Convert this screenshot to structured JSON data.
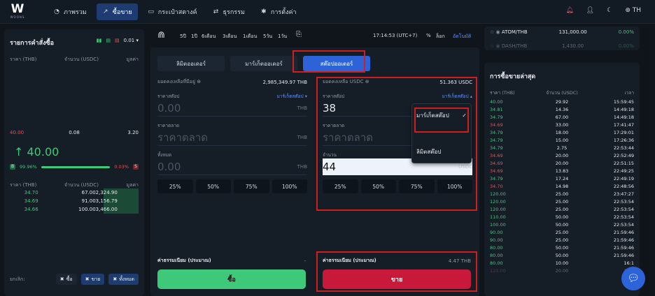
{
  "brand": {
    "mark": "W",
    "name": "WOONS"
  },
  "nav": [
    {
      "icon": "◔",
      "label": "ภาพรวม"
    },
    {
      "icon": "↗",
      "label": "ซื้อขาย"
    },
    {
      "icon": "▭",
      "label": "กระเป๋าสตางค์"
    },
    {
      "icon": "⇄",
      "label": "ธุรกรรม"
    },
    {
      "icon": "✱",
      "label": "การตั้งค่า"
    }
  ],
  "top_right": {
    "lang": "TH"
  },
  "orderbook": {
    "title": "รายการคำสั่งซื้อ",
    "tick": "0.01",
    "cols": [
      "ราคา (THB)",
      "จำนวน (USDC)",
      "มูลค่า"
    ],
    "ask": {
      "price": "40.00",
      "qty": "0.08",
      "value": "3.20"
    },
    "last_price": "↑ 40.00",
    "buy_pct": "99.96%",
    "sell_pct": "0.03%",
    "buy_badge": "B",
    "sell_badge": "S",
    "bid_cols": [
      "ราคา (THB)",
      "จำนวน (USDC)",
      "มูลค่า"
    ],
    "bids": [
      {
        "price": "34.70",
        "qty": "67.00",
        "value": "2,324.90"
      },
      {
        "price": "34.69",
        "qty": "91.00",
        "value": "3,156.79"
      },
      {
        "price": "34.66",
        "qty": "100.00",
        "value": "3,466.00"
      }
    ],
    "footer_label": "ยกเลิก:",
    "footer_buttons": [
      "ซื้อ",
      "ขาย",
      "ทั้งหมด"
    ]
  },
  "chart_toolbar": {
    "ranges": [
      "5ปี",
      "1ปี",
      "6เดือน",
      "3เดือน",
      "1เดือน",
      "5วัน",
      "1วัน"
    ],
    "time": "17:14:53 (UTC+7)",
    "pct": "%",
    "log": "ล็อก",
    "auto": "อัตโนมัติ"
  },
  "order_form": {
    "tabs": [
      "ลิมิตออเดอร์",
      "มาร์เก็ตออเดอร์",
      "สต๊อปออเดอร์"
    ],
    "buy": {
      "balance_label": "ยอดคงเหลือที่มีอยู่",
      "balance": "2,985,349.97 THB",
      "stop_label": "ราคาสต๊อป",
      "stop_select": "มาร์เก็ตสต๊อป",
      "stop_value": "0.00",
      "unit": "THB",
      "price_label": "ราคาตลาด",
      "price_value": "ราคาตลาด",
      "total_label": "ทั้งหมด",
      "total_value": "0.00",
      "pcts": [
        "25%",
        "50%",
        "75%",
        "100%"
      ],
      "fee_label": "ค่าธรรมเนียม (ประมาณ)",
      "fee_value": "-",
      "button": "ซื้อ"
    },
    "sell": {
      "balance_label": "ยอดคงเหลือ USDC",
      "balance": "51.363 USDC",
      "stop_label": "ราคาสต๊อป",
      "stop_select": "มาร์เก็ตสต๊อป",
      "stop_value": "38",
      "price_label": "ราคาตลาด",
      "price_value": "ราคาตลาด",
      "amount_label": "จำนวน",
      "amount_value": "44",
      "amount_unit": "USDC",
      "pcts": [
        "25%",
        "50%",
        "75%",
        "100%"
      ],
      "fee_label": "ค่าธรรมเนียม (ประมาณ)",
      "fee_value": "4.47 THB",
      "button": "ขาย"
    },
    "dropdown": {
      "options": [
        "มาร์เก็ตสต๊อป",
        "ลิมิตสต๊อป"
      ]
    }
  },
  "ticker": {
    "rows": [
      {
        "pair": "ATOM/THB",
        "price": "131,000.00",
        "chg": "0.00%"
      },
      {
        "pair": "DASH/THB",
        "price": "1,430.00",
        "chg": "0.00%"
      }
    ]
  },
  "trades": {
    "title": "การซื้อขายล่าสุด",
    "cols": [
      "ราคา (THB)",
      "จำนวน (USDC)",
      "เวลา"
    ],
    "rows": [
      {
        "p": "40.00",
        "q": "29.92",
        "t": "15:59:45",
        "s": "g"
      },
      {
        "p": "34.81",
        "q": "14.36",
        "t": "14:49:18",
        "s": "g"
      },
      {
        "p": "34.79",
        "q": "67.00",
        "t": "14:49:18",
        "s": "g"
      },
      {
        "p": "34.69",
        "q": "33.00",
        "t": "17:41:47",
        "s": "r"
      },
      {
        "p": "34.79",
        "q": "18.00",
        "t": "17:29:01",
        "s": "g"
      },
      {
        "p": "34.79",
        "q": "15.00",
        "t": "17:26:36",
        "s": "g"
      },
      {
        "p": "34.79",
        "q": "2.75",
        "t": "22:53:44",
        "s": "g"
      },
      {
        "p": "34.69",
        "q": "20.00",
        "t": "22:52:49",
        "s": "r"
      },
      {
        "p": "34.69",
        "q": "20.00",
        "t": "22:51:15",
        "s": "r"
      },
      {
        "p": "34.69",
        "q": "13.83",
        "t": "22:49:25",
        "s": "r"
      },
      {
        "p": "34.79",
        "q": "17.24",
        "t": "22:49:19",
        "s": "g"
      },
      {
        "p": "34.70",
        "q": "14.98",
        "t": "22:48:56",
        "s": "r"
      },
      {
        "p": "120.00",
        "q": "25.00",
        "t": "23:47:27",
        "s": "g"
      },
      {
        "p": "120.00",
        "q": "25.00",
        "t": "22:53:54",
        "s": "g"
      },
      {
        "p": "120.00",
        "q": "25.00",
        "t": "22:53:54",
        "s": "g"
      },
      {
        "p": "110.00",
        "q": "50.00",
        "t": "22:53:54",
        "s": "g"
      },
      {
        "p": "100.00",
        "q": "50.00",
        "t": "22:53:54",
        "s": "g"
      },
      {
        "p": "90.00",
        "q": "25.00",
        "t": "21:59:46",
        "s": "g"
      },
      {
        "p": "90.00",
        "q": "25.00",
        "t": "21:59:46",
        "s": "g"
      },
      {
        "p": "80.00",
        "q": "50.00",
        "t": "21:59:46",
        "s": "g"
      },
      {
        "p": "80.00",
        "q": "50.00",
        "t": "21:59:46",
        "s": "g"
      },
      {
        "p": "80.00",
        "q": "10.00",
        "t": "16:1",
        "s": "g"
      },
      {
        "p": "120.00",
        "q": "20.00",
        "t": "16:1",
        "s": "r"
      }
    ]
  }
}
